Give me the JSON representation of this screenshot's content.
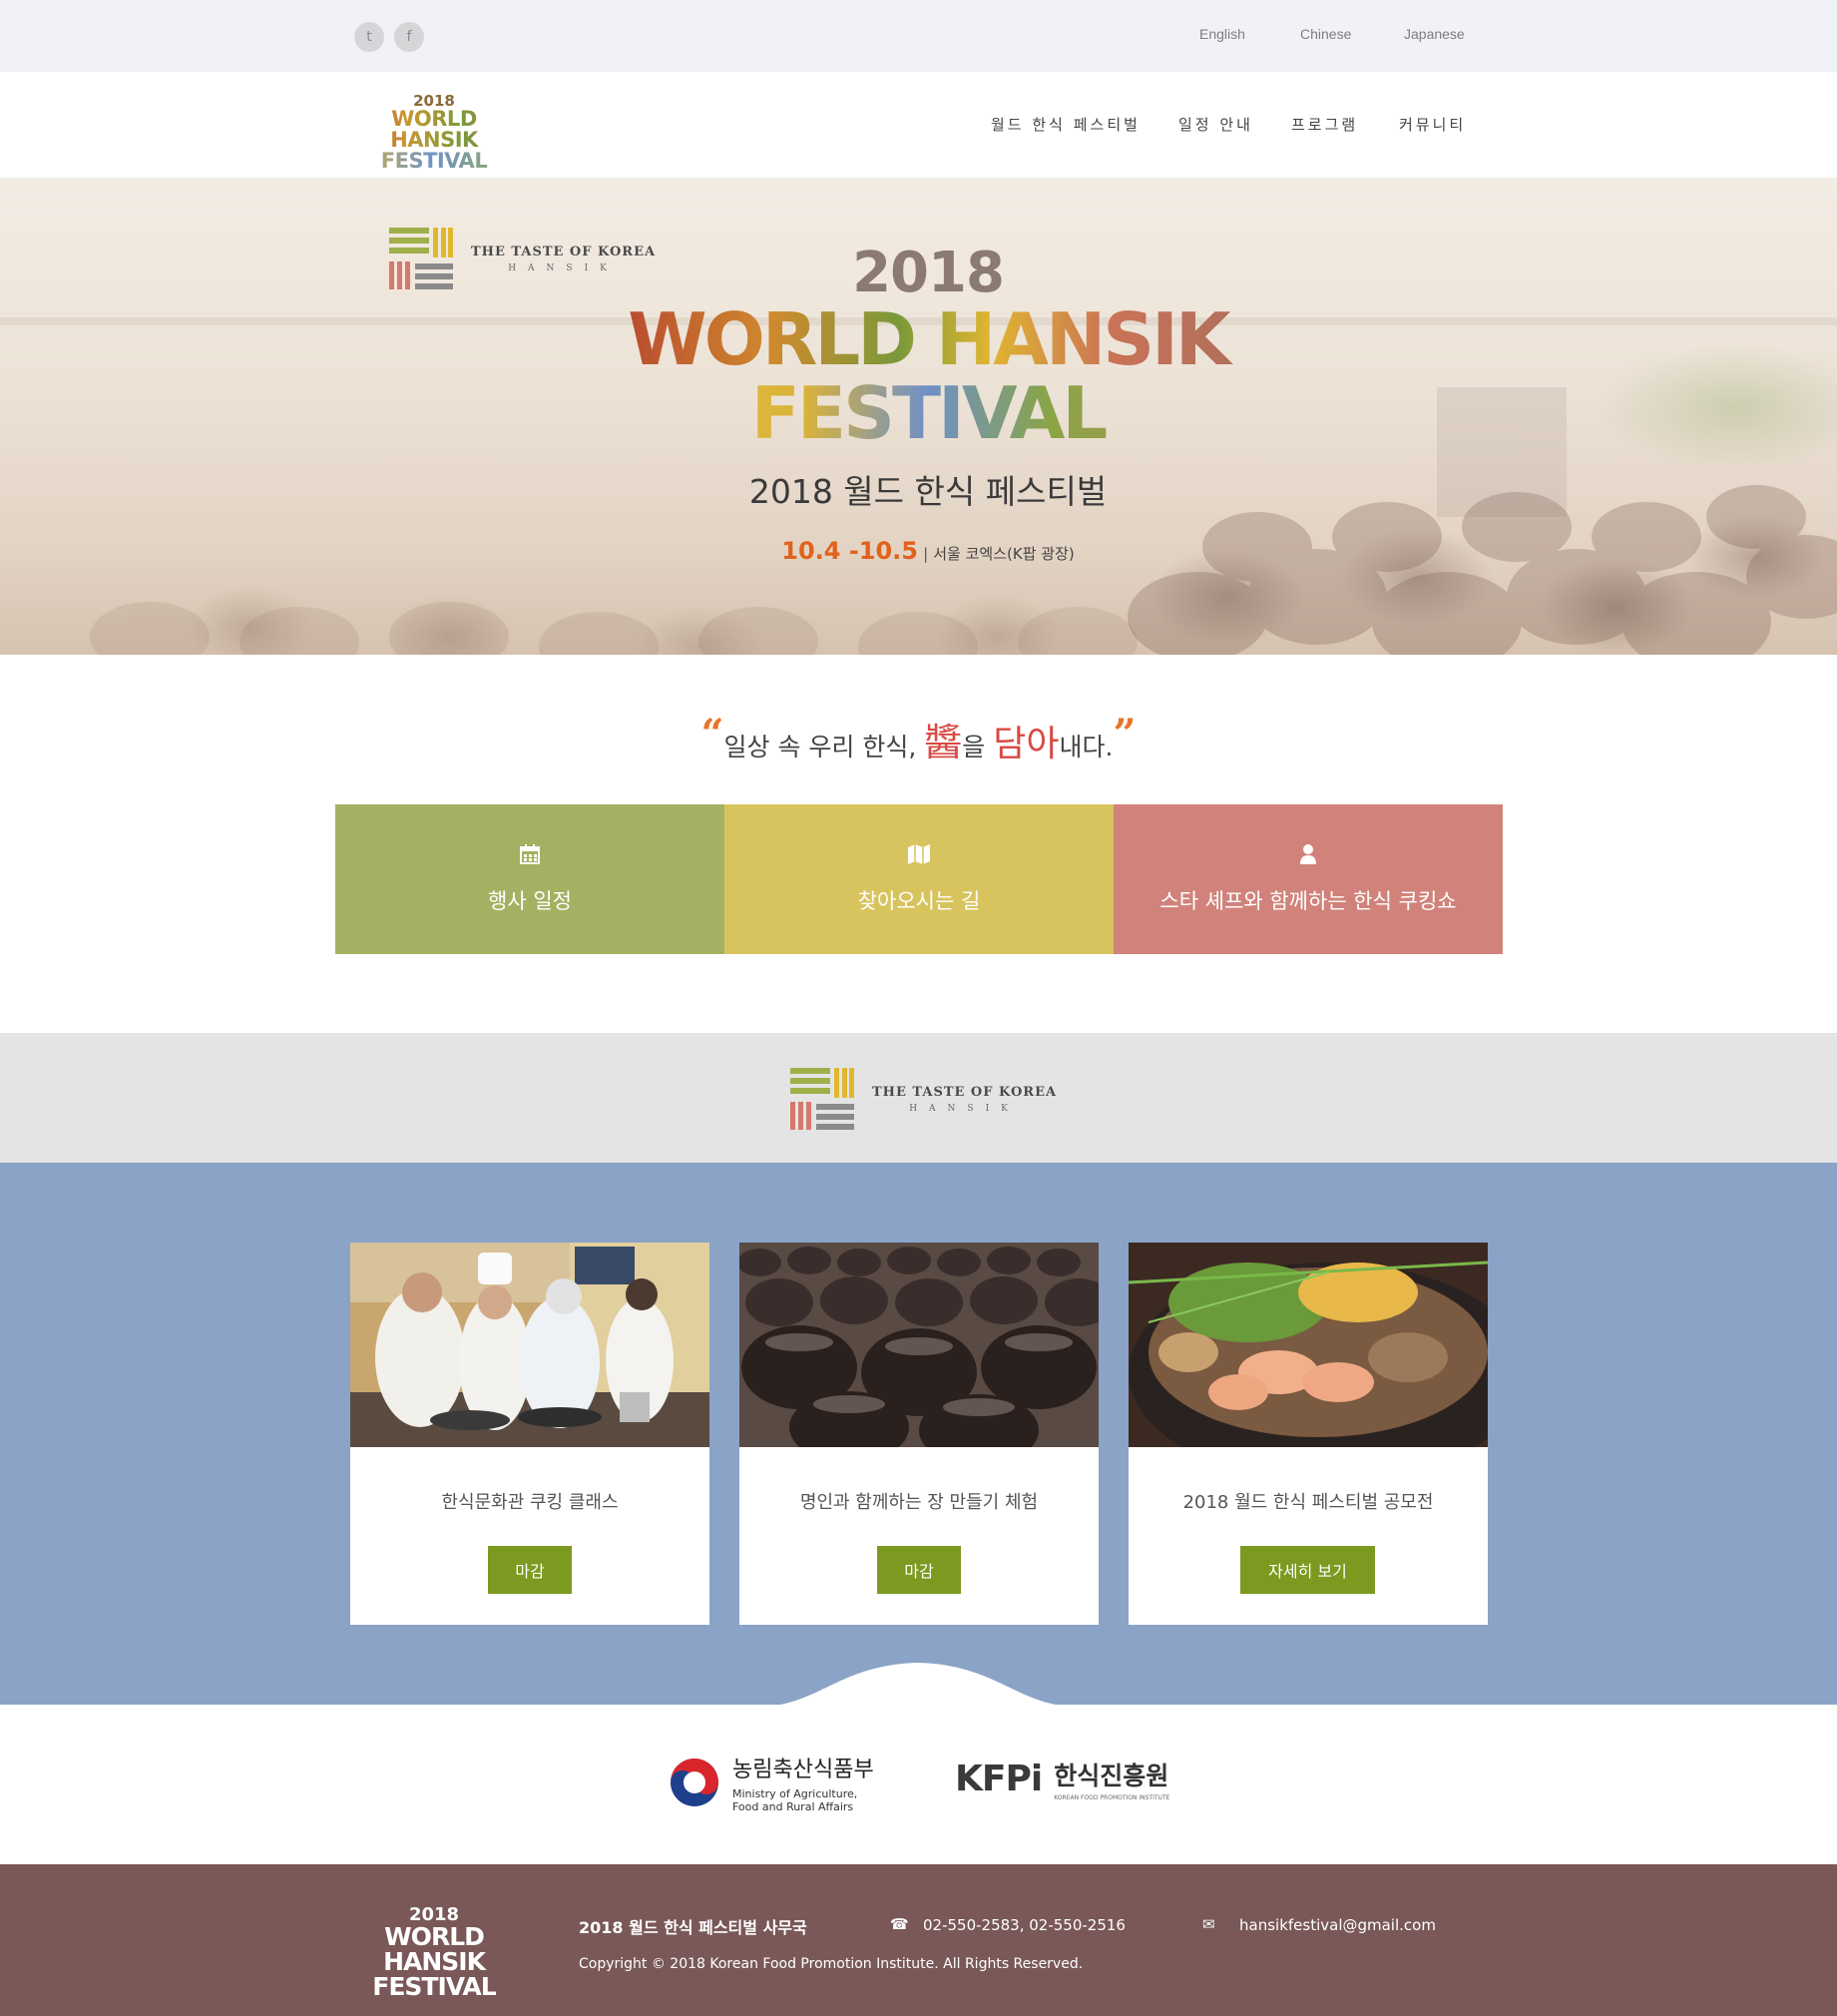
{
  "topbar": {
    "social": [
      {
        "name": "twitter",
        "glyph": "t"
      },
      {
        "name": "facebook",
        "glyph": "f"
      }
    ],
    "languages": [
      "English",
      "Chinese",
      "Japanese"
    ]
  },
  "header": {
    "logo": {
      "year": "2018",
      "line1": "WORLD HANSIK",
      "line2": "FESTIVAL"
    },
    "nav": [
      "월드 한식 페스티벌",
      "일정 안내",
      "프로그램",
      "커뮤니티"
    ]
  },
  "hero": {
    "taste_logo": {
      "line1": "THE TASTE OF KOREA",
      "line2": "HANSIK"
    },
    "title_year": "2018",
    "title_line1": "WORLD HANSIK",
    "title_line2": "FESTIVAL",
    "subtitle": "2018 월드 한식 페스티벌",
    "date": "10.4 -10.5",
    "date_sep": "|",
    "place": "서울 코엑스(K팝 광장)"
  },
  "slogan": {
    "open_quote": "“",
    "part1": "일상 속 우리 한식, ",
    "han_char": "醬",
    "part2": "을 ",
    "accent": "담아",
    "part3": "내다.",
    "close_quote": "”"
  },
  "tiles": [
    {
      "icon": "calendar-icon",
      "label": "행사 일정",
      "color": "#a3b262"
    },
    {
      "icon": "map-icon",
      "label": "찾아오시는 길",
      "color": "#d8c45e"
    },
    {
      "icon": "user-icon",
      "label": "스타 셰프와 함께하는 한식 쿠킹쇼",
      "color": "#d1837b"
    }
  ],
  "band_logo": {
    "line1": "THE TASTE OF KOREA",
    "line2": "HANSIK"
  },
  "cards": [
    {
      "title": "한식문화관 쿠킹 클래스",
      "button": "마감"
    },
    {
      "title": "명인과 함께하는 장 만들기 체험",
      "button": "마감"
    },
    {
      "title": "2018 월드 한식 페스티벌 공모전",
      "button": "자세히 보기"
    }
  ],
  "sponsors": {
    "ministry": {
      "name": "농림축산식품부",
      "en_line1": "Ministry of Agriculture,",
      "en_line2": "Food and Rural Affairs"
    },
    "kfpi": {
      "mark": "KFPi",
      "name": "한식진흥원",
      "en": "KOREAN FOOD PROMOTION INSTITUTE"
    }
  },
  "footer": {
    "logo": {
      "year": "2018",
      "line1": "WORLD HANSIK",
      "line2": "FESTIVAL"
    },
    "office": "2018 월드 한식 페스티벌 사무국",
    "phone": "02-550-2583, 02-550-2516",
    "email": "hansikfestival@gmail.com",
    "copyright": "Copyright © 2018 Korean Food Promotion Institute. All Rights Reserved."
  },
  "colors": {
    "accent_orange": "#e0621c",
    "slogan_red": "#d84a43",
    "button_green": "#7b9a1f",
    "blue_section": "#8aa3c6",
    "footer_brown": "#7a5858"
  }
}
